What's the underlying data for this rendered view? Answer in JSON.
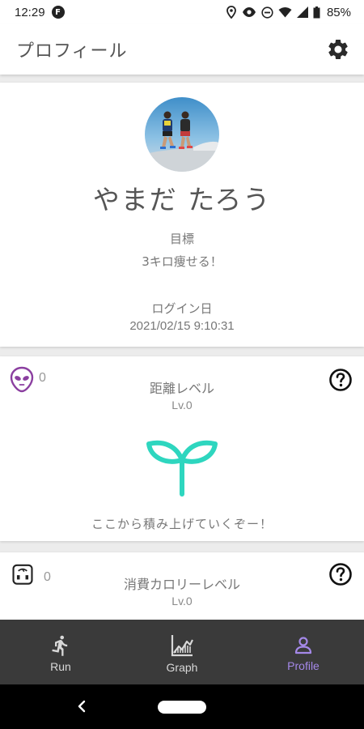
{
  "status_bar": {
    "time": "12:29",
    "notification_badge": "F",
    "battery": "85%",
    "icons": [
      "location-icon",
      "eye-icon",
      "dnd-icon",
      "wifi-icon",
      "signal-icon",
      "battery-icon"
    ]
  },
  "app_bar": {
    "title": "プロフィール",
    "settings_icon": "gear-icon"
  },
  "profile": {
    "name": "やまだ たろう",
    "goal_label": "目標",
    "goal_value": "3キロ痩せる！",
    "login_label": "ログイン日",
    "login_value": "2021/02/15 9:10:31"
  },
  "levels": [
    {
      "icon": "alien-icon",
      "count": "0",
      "title": "距離レベル",
      "level": "Lv.0",
      "message": "ここから積み上げていくぞー！",
      "accent": "#8b3fa0"
    },
    {
      "icon": "scale-icon",
      "count": "0",
      "title": "消費カロリーレベル",
      "level": "Lv.0"
    }
  ],
  "colors": {
    "sprout": "#2ed6bf",
    "nav_active": "#a488e8",
    "nav_inactive": "#d8d8d8",
    "nav_bg": "#3a3a3a"
  },
  "bottom_nav": {
    "items": [
      {
        "label": "Run",
        "icon": "runner-icon",
        "active": false
      },
      {
        "label": "Graph",
        "icon": "chart-icon",
        "active": false
      },
      {
        "label": "Profile",
        "icon": "person-icon",
        "active": true
      }
    ]
  }
}
